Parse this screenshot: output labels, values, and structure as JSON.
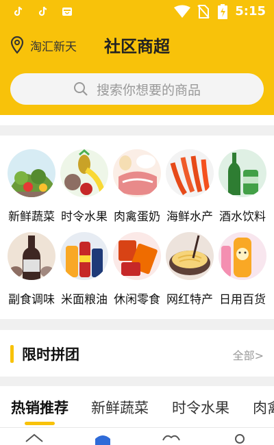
{
  "status_bar": {
    "time": "5:15",
    "left_icons": [
      "tiktok-icon",
      "tiktok-icon",
      "mail-icon"
    ],
    "right_icons": [
      "wifi-icon",
      "no-sim-icon",
      "battery-icon"
    ]
  },
  "header": {
    "location": "淘汇新天",
    "title": "社区商超",
    "background_color": "#f8c20a"
  },
  "search": {
    "placeholder": "搜索你想要的商品"
  },
  "categories": [
    {
      "label": "新鲜蔬菜",
      "icon": "vegetables-image"
    },
    {
      "label": "时令水果",
      "icon": "fruits-image"
    },
    {
      "label": "肉禽蛋奶",
      "icon": "meat-eggs-image"
    },
    {
      "label": "海鲜水产",
      "icon": "seafood-image"
    },
    {
      "label": "酒水饮料",
      "icon": "drinks-image"
    },
    {
      "label": "副食调味",
      "icon": "condiments-image"
    },
    {
      "label": "米面粮油",
      "icon": "rice-oil-image"
    },
    {
      "label": "休闲零食",
      "icon": "snacks-image"
    },
    {
      "label": "网红特产",
      "icon": "specialty-noodles-image"
    },
    {
      "label": "日用百货",
      "icon": "daily-goods-image"
    }
  ],
  "flash_sale": {
    "title": "限时拼团",
    "all_label": "全部>"
  },
  "tabs": [
    {
      "label": "热销推荐",
      "active": true
    },
    {
      "label": "新鲜蔬菜",
      "active": false
    },
    {
      "label": "时令水果",
      "active": false
    },
    {
      "label": "肉禽",
      "active": false
    }
  ],
  "bottom_nav": [
    "home-icon",
    "category-icon",
    "cart-icon",
    "profile-icon"
  ]
}
